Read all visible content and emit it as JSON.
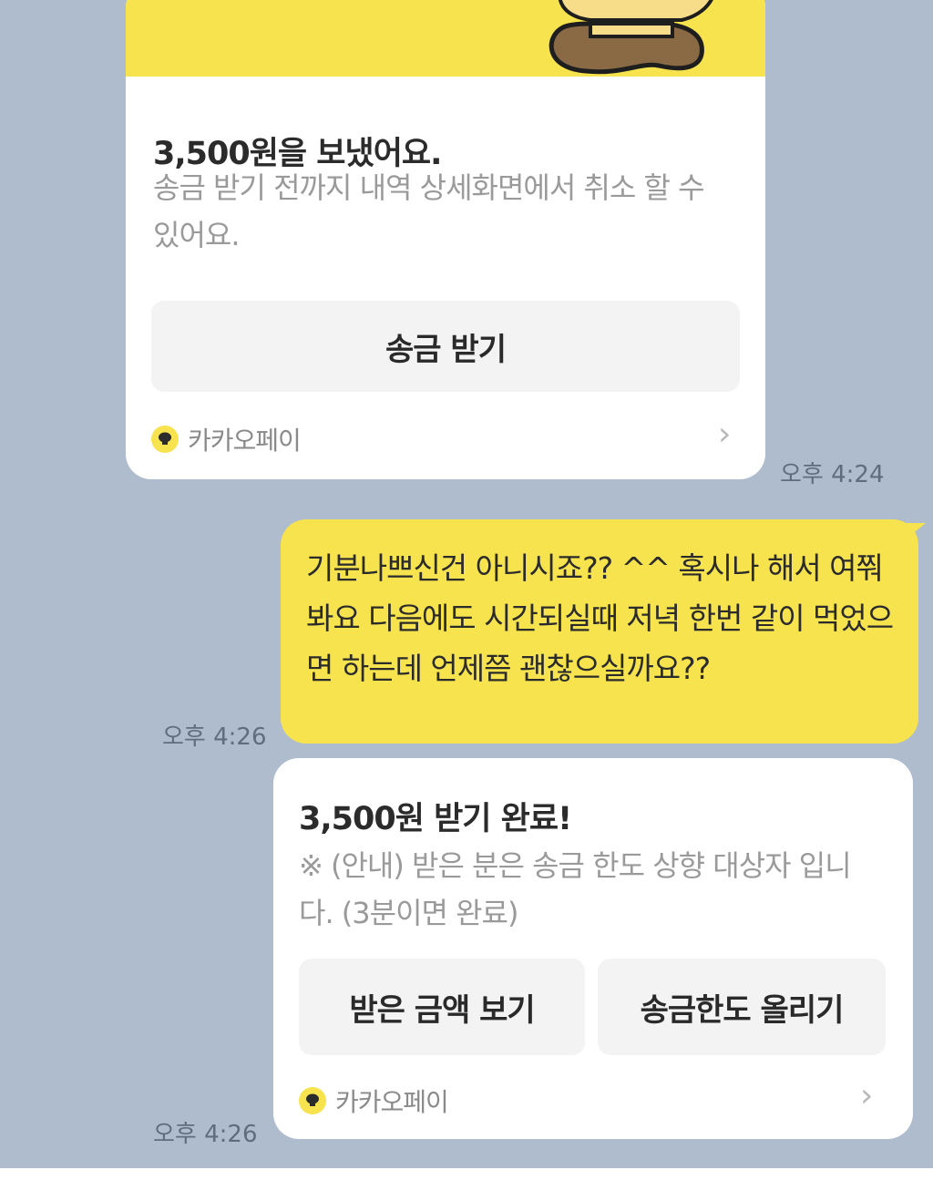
{
  "messages": [
    {
      "type": "kakaopay_card",
      "title": "3,500원을 보냈어요.",
      "description": "송금 받기 전까지 내역 상세화면에서 취소 할 수 있어요.",
      "buttons": [
        "송금 받기"
      ],
      "brand": "카카오페이",
      "time": "오후 4:24"
    },
    {
      "type": "text",
      "text": "기분나쁘신건 아니시죠?? ^^ 혹시나 해서 여쭤봐요 다음에도 시간되실때 저녁 한번 같이 먹었으면 하는데 언제쯤 괜찮으실까요??",
      "time": "오후 4:26"
    },
    {
      "type": "kakaopay_card",
      "title": "3,500원 받기 완료!",
      "description": "※ (안내) 받은 분은 송금 한도 상향 대상자 입니다. (3분이면 완료)",
      "buttons": [
        "받은 금액 보기",
        "송금한도 올리기"
      ],
      "brand": "카카오페이",
      "time": "오후 4:26"
    }
  ],
  "colors": {
    "chat_background": "#aebccd",
    "bubble_yellow": "#f6e34e",
    "card_white": "#ffffff",
    "button_gray": "#f3f3f3"
  },
  "icons": [
    "kakaopay-logo-icon",
    "chevron-right-icon"
  ]
}
